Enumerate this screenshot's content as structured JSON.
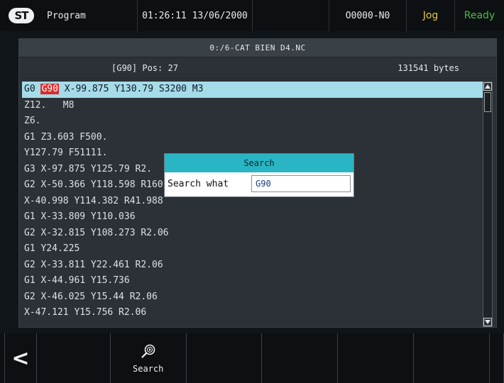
{
  "status_bar": {
    "logo_text": "ST",
    "mode": "Program",
    "datetime": "01:26:11 13/06/2000",
    "program_number": "O0000-N0",
    "jog": "Jog",
    "ready": "Ready",
    "colors": {
      "jog": "#e6c637",
      "ready": "#4dbb3c"
    }
  },
  "file_panel": {
    "path": "0:/6-CAT BIEN D4.NC",
    "pos_info": "[G90] Pos: 27",
    "file_size": "131541 bytes"
  },
  "code": {
    "first_line": {
      "before": "G0 ",
      "match": "G90",
      "after": " X-99.875 Y130.79 S3200 M3"
    },
    "lines": [
      "Z12.   M8",
      "Z6.",
      "G1 Z3.603 F500.",
      "Y127.79 F51111.",
      "G3 X-97.875 Y125.79 R2.",
      "G2 X-50.366 Y118.598 R160",
      "X-40.998 Y114.382 R41.988",
      "G1 X-33.809 Y110.036",
      "G2 X-32.815 Y108.273 R2.06",
      "G1 Y24.225",
      "G2 X-33.811 Y22.461 R2.06",
      "G1 X-44.961 Y15.736",
      "G2 X-46.025 Y15.44 R2.06",
      "X-47.121 Y15.756 R2.06"
    ]
  },
  "search_dialog": {
    "title": "Search",
    "label": "Search what",
    "value": "G90"
  },
  "softkeys": {
    "back_glyph": "<",
    "search_label": "Search"
  },
  "icons": [
    "logo",
    "scroll-up-icon",
    "scroll-down-icon",
    "back-arrow-icon",
    "search-icon"
  ]
}
